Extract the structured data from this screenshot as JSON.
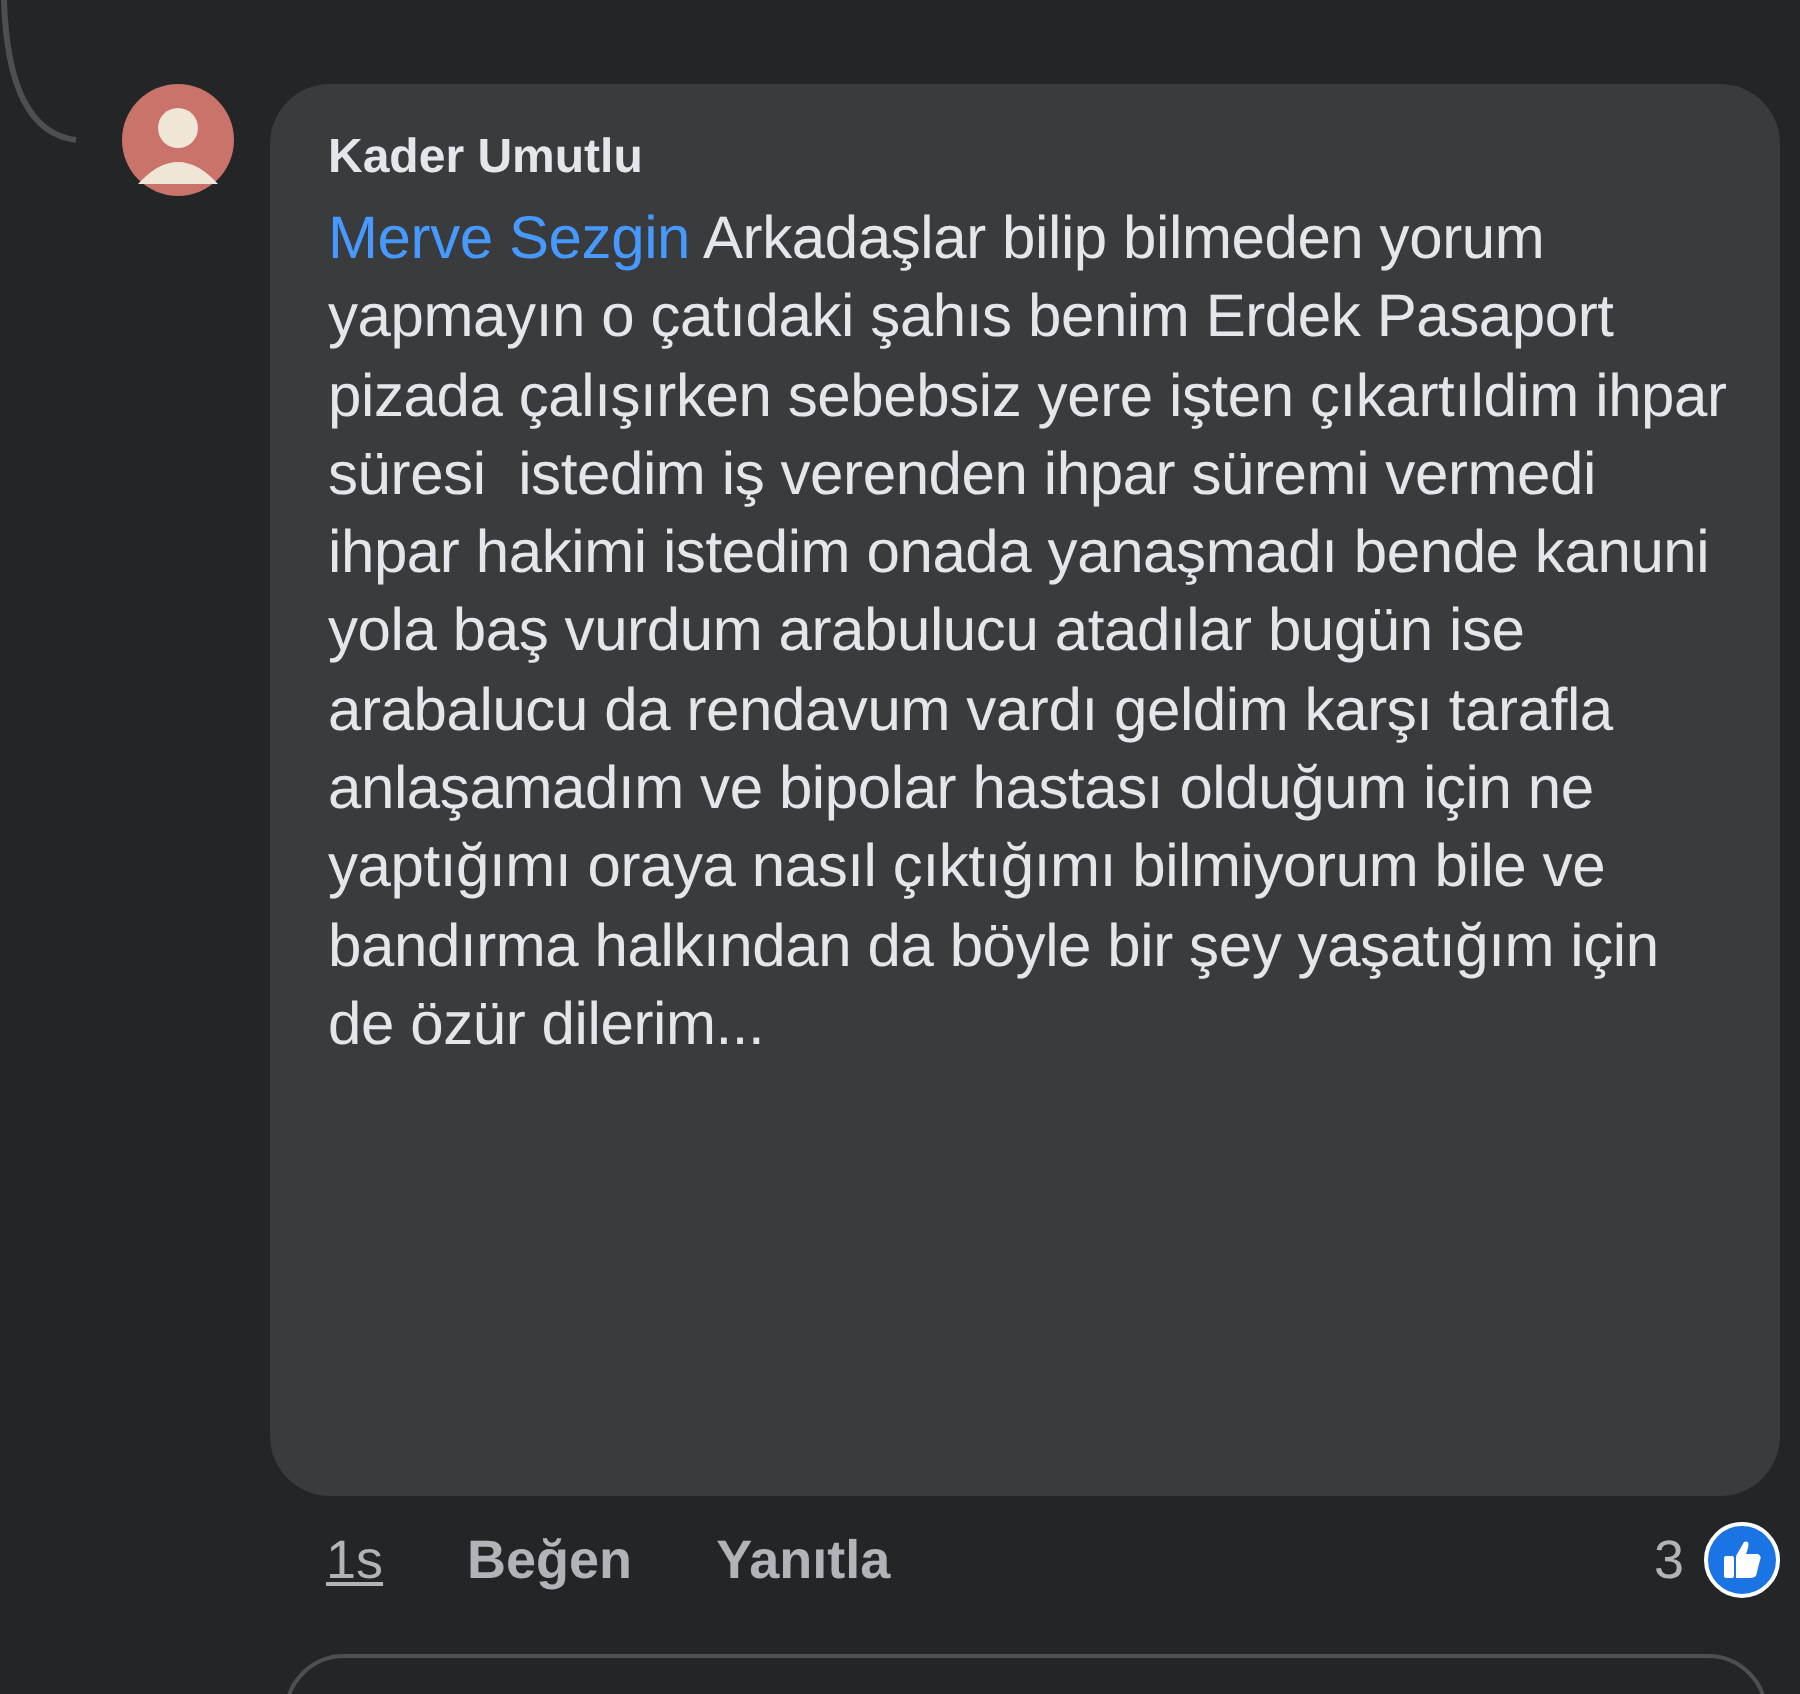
{
  "comment": {
    "author": "Kader Umutlu",
    "mention": "Merve Sezgin",
    "text": "Arkadaşlar bilip bilmeden yorum yapmayın o çatıdaki şahıs benim Erdek Pasaport pizada çalışırken sebebsiz yere işten çıkartıldim ihpar süresi  istedim iş verenden ihpar süremi vermedi ihpar hakimi istedim onada yanaşmadı bende kanuni yola baş vurdum arabulucu atadılar bugün ise arabalucu da rendavum vardı geldim karşı tarafla anlaşamadım ve bipolar hastası olduğum için ne yaptığımı oraya nasıl çıktığımı bilmiyorum bile ve bandırma halkından da böyle bir şey yaşatığım için de özür dilerim...",
    "time": "1s",
    "actions": [
      "Beğen",
      "Yanıtla"
    ],
    "reaction_count": "3"
  }
}
